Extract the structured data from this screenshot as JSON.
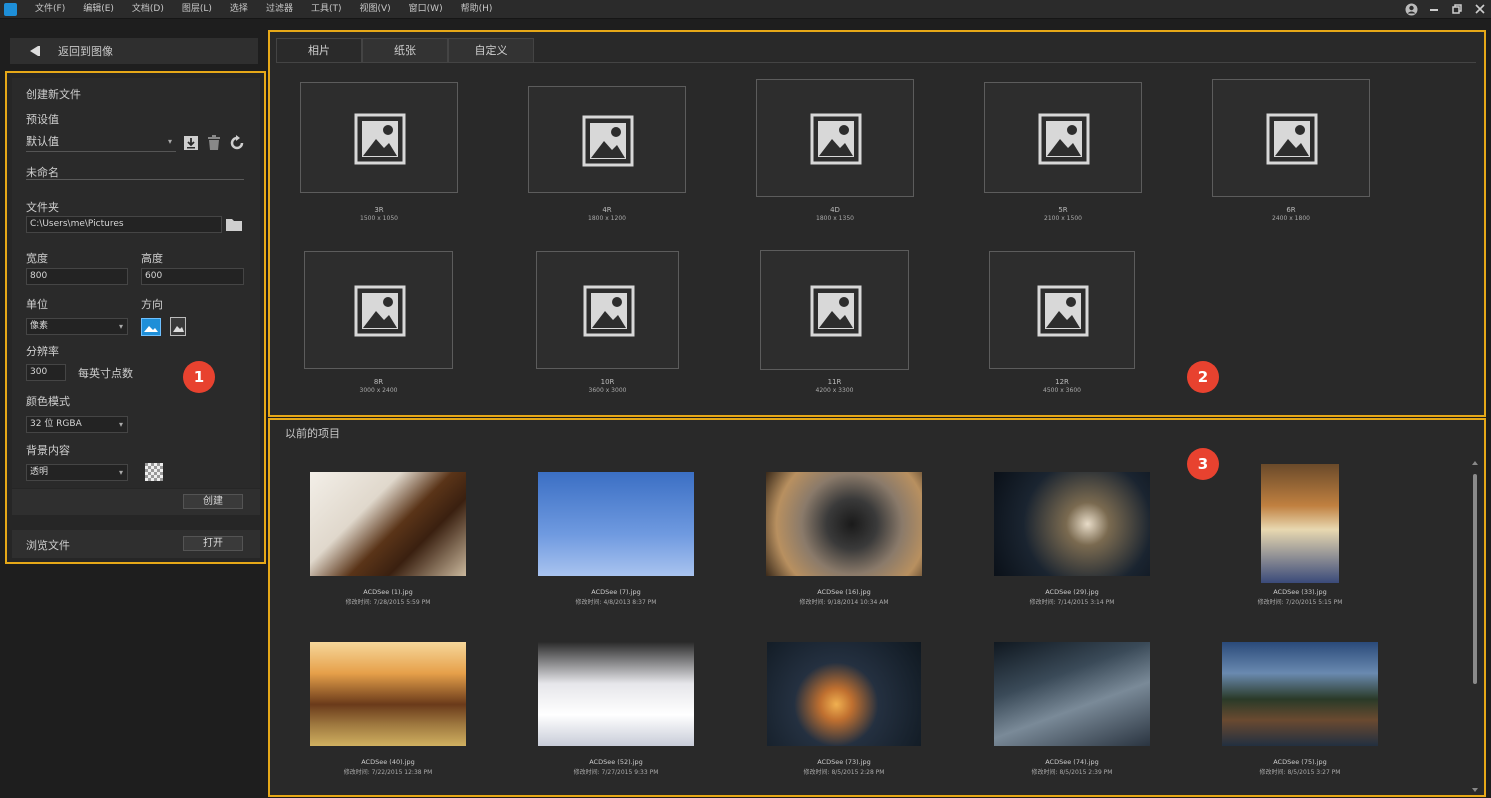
{
  "menu": [
    "文件(F)",
    "编辑(E)",
    "文档(D)",
    "图层(L)",
    "选择",
    "过滤器",
    "工具(T)",
    "视图(V)",
    "窗口(W)",
    "帮助(H)"
  ],
  "back_label": "返回到图像",
  "left": {
    "create_title": "创建新文件",
    "preset_label": "预设值",
    "preset_value": "默认值",
    "name_value": "未命名",
    "folder_label": "文件夹",
    "folder_value": "C:\\Users\\me\\Pictures",
    "width_label": "宽度",
    "width_value": "800",
    "height_label": "高度",
    "height_value": "600",
    "unit_label": "单位",
    "unit_value": "像素",
    "orientation_label": "方向",
    "resolution_label": "分辨率",
    "resolution_value": "300",
    "resolution_unit": "每英寸点数",
    "color_mode_label": "颜色模式",
    "color_mode_value": "32 位 RGBA",
    "background_label": "背景内容",
    "background_value": "透明",
    "create_button": "创建",
    "browse_label": "浏览文件",
    "open_button": "打开"
  },
  "badges": [
    "1",
    "2",
    "3"
  ],
  "tabs": [
    "相片",
    "纸张",
    "自定义"
  ],
  "templates": [
    {
      "name": "3R",
      "size": "1500 x 1050"
    },
    {
      "name": "4R",
      "size": "1800 x 1200"
    },
    {
      "name": "4D",
      "size": "1800 x 1350"
    },
    {
      "name": "5R",
      "size": "2100 x 1500"
    },
    {
      "name": "6R",
      "size": "2400 x 1800"
    },
    {
      "name": "8R",
      "size": "3000 x 2400"
    },
    {
      "name": "10R",
      "size": "3600 x 3000"
    },
    {
      "name": "11R",
      "size": "4200 x 3300"
    },
    {
      "name": "12R",
      "size": "4500 x 3600"
    }
  ],
  "recent_title": "以前的项目",
  "recent": [
    {
      "name": "ACDSee (1).jpg",
      "date": "修改时间: 7/28/2015 5:59 PM"
    },
    {
      "name": "ACDSee (7).jpg",
      "date": "修改时间: 4/8/2013 8:37 PM"
    },
    {
      "name": "ACDSee (16).jpg",
      "date": "修改时间: 9/18/2014 10:34 AM"
    },
    {
      "name": "ACDSee (29).jpg",
      "date": "修改时间: 7/14/2015 3:14 PM"
    },
    {
      "name": "ACDSee (33).jpg",
      "date": "修改时间: 7/20/2015 5:15 PM"
    },
    {
      "name": "ACDSee (40).jpg",
      "date": "修改时间: 7/22/2015 12:38 PM"
    },
    {
      "name": "ACDSee (52).jpg",
      "date": "修改时间: 7/27/2015 9:33 PM"
    },
    {
      "name": "ACDSee (73).jpg",
      "date": "修改时间: 8/5/2015 2:28 PM"
    },
    {
      "name": "ACDSee (74).jpg",
      "date": "修改时间: 8/5/2015 2:39 PM"
    },
    {
      "name": "ACDSee (75).jpg",
      "date": "修改时间: 8/5/2015 3:27 PM"
    }
  ],
  "colors": {
    "highlight": "#e6a818",
    "badge": "#e8422f",
    "accent": "#1e8fd8"
  }
}
